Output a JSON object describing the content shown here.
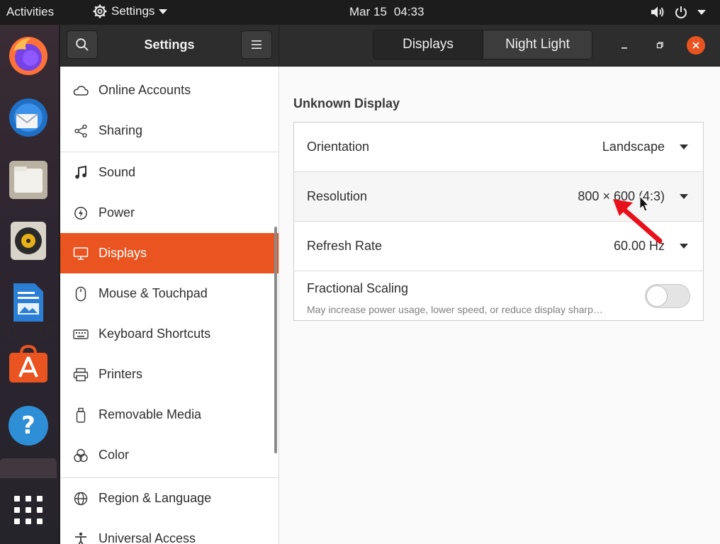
{
  "topbar": {
    "activities": "Activities",
    "app_menu": "Settings",
    "date": "Mar 15",
    "time": "04:33"
  },
  "dock": {
    "apps": [
      "firefox-icon",
      "thunderbird-icon",
      "files-icon",
      "rhythmbox-icon",
      "libreoffice-writer-icon",
      "ubuntu-software-icon",
      "help-icon",
      "app-grid-icon"
    ]
  },
  "window": {
    "sidebar_title": "Settings",
    "tabs": [
      {
        "label": "Displays",
        "active": true
      },
      {
        "label": "Night Light",
        "active": false
      }
    ]
  },
  "sidebar": {
    "items": [
      {
        "label": "Online Accounts",
        "icon": "cloud-icon"
      },
      {
        "label": "Sharing",
        "icon": "share-icon"
      },
      {
        "label": "Sound",
        "icon": "music-note-icon"
      },
      {
        "label": "Power",
        "icon": "power-icon"
      },
      {
        "label": "Displays",
        "icon": "display-icon",
        "active": true
      },
      {
        "label": "Mouse & Touchpad",
        "icon": "mouse-icon"
      },
      {
        "label": "Keyboard Shortcuts",
        "icon": "keyboard-icon"
      },
      {
        "label": "Printers",
        "icon": "printer-icon"
      },
      {
        "label": "Removable Media",
        "icon": "usb-icon"
      },
      {
        "label": "Color",
        "icon": "color-icon"
      },
      {
        "label": "Region & Language",
        "icon": "globe-icon"
      },
      {
        "label": "Universal Access",
        "icon": "accessibility-icon"
      }
    ]
  },
  "display": {
    "section_title": "Unknown Display",
    "rows": [
      {
        "label": "Orientation",
        "value": "Landscape"
      },
      {
        "label": "Resolution",
        "value": "800 × 600 (4:3)"
      },
      {
        "label": "Refresh Rate",
        "value": "60.00 Hz"
      }
    ],
    "fractional_scaling": {
      "label": "Fractional Scaling",
      "description": "May increase power usage, lower speed, or reduce display sharp…",
      "enabled": false
    }
  },
  "colors": {
    "accent": "#e95420",
    "annotation_arrow": "#e8101a"
  }
}
